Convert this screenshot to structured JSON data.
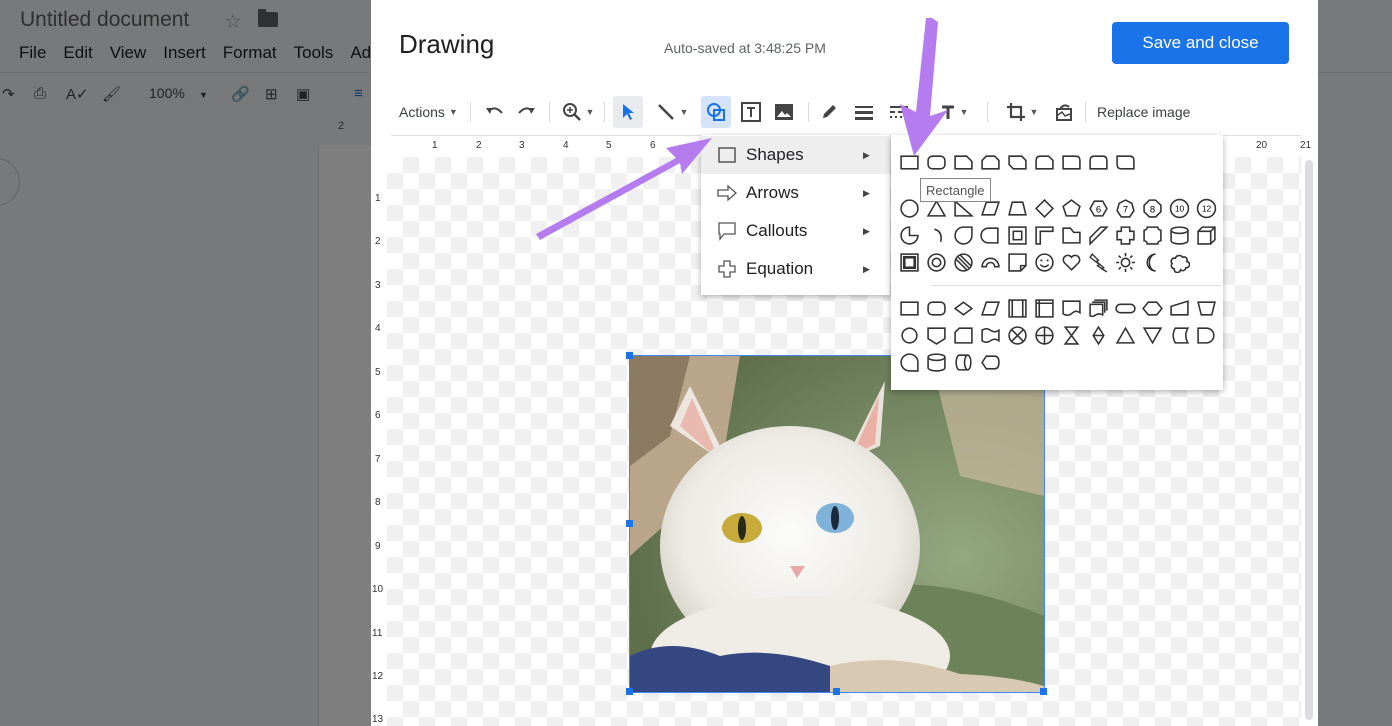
{
  "docs": {
    "title": "Untitled document",
    "menu": [
      "File",
      "Edit",
      "View",
      "Insert",
      "Format",
      "Tools",
      "Ad"
    ],
    "zoom": "100%",
    "ruler_mark": "2"
  },
  "dialog": {
    "title": "Drawing",
    "autosave": "Auto-saved at 3:48:25 PM",
    "save_label": "Save and close",
    "toolbar": {
      "actions_label": "Actions",
      "replace_label": "Replace image"
    }
  },
  "ruler": {
    "h": [
      "1",
      "2",
      "3",
      "4",
      "5",
      "6",
      "20",
      "21"
    ],
    "v": [
      "1",
      "2",
      "3",
      "4",
      "5",
      "6",
      "7",
      "8",
      "9",
      "10",
      "11",
      "12",
      "13"
    ]
  },
  "shape_menu": {
    "items": [
      {
        "label": "Shapes",
        "icon": "square-icon"
      },
      {
        "label": "Arrows",
        "icon": "arrow-icon"
      },
      {
        "label": "Callouts",
        "icon": "callout-icon"
      },
      {
        "label": "Equation",
        "icon": "plus-icon"
      }
    ]
  },
  "tooltip": "Rectangle",
  "colors": {
    "accent": "#1a73e8",
    "arrow": "#b57cf0"
  }
}
